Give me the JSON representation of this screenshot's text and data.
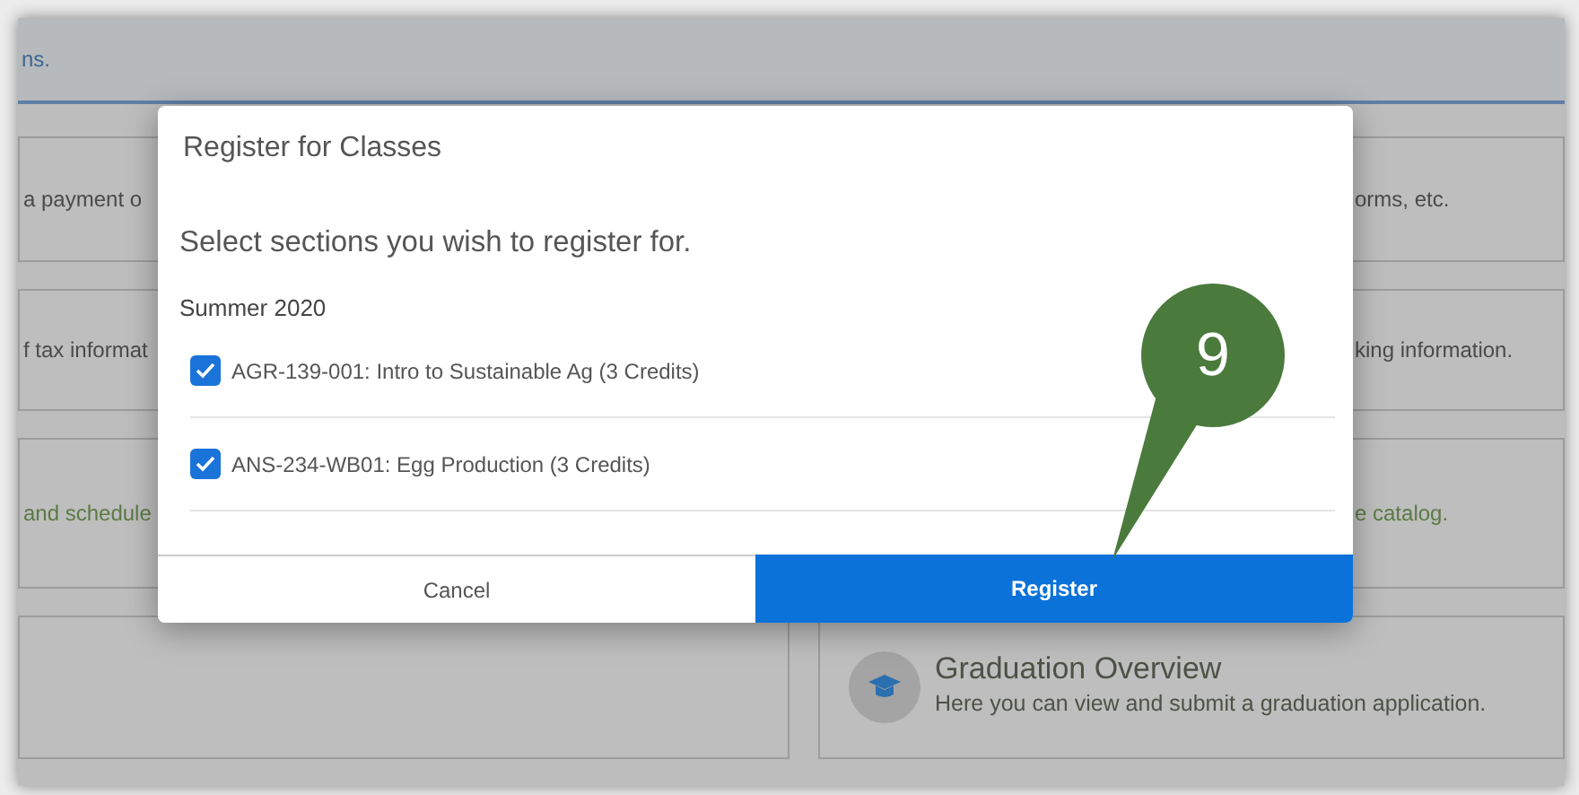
{
  "background": {
    "banner_text": "ns.",
    "cards": [
      {
        "kind": "text",
        "text": "a payment o"
      },
      {
        "kind": "text",
        "text": "orms, etc."
      },
      {
        "kind": "text",
        "text": "f tax informat"
      },
      {
        "kind": "text",
        "text": "king information."
      },
      {
        "kind": "link",
        "text": "and schedule"
      },
      {
        "kind": "link",
        "text": "e catalog."
      },
      {
        "kind": "empty"
      },
      {
        "kind": "feature",
        "title": "Graduation Overview",
        "text": "Here you can view and submit a graduation application."
      }
    ]
  },
  "dialog": {
    "title": "Register for Classes",
    "prompt": "Select sections you wish to register for.",
    "term": "Summer 2020",
    "sections": [
      {
        "label": "AGR-139-001: Intro to Sustainable Ag (3 Credits)",
        "checked": true
      },
      {
        "label": "ANS-234-WB01: Egg Production (3 Credits)",
        "checked": true
      }
    ],
    "buttons": [
      {
        "label": "Cancel",
        "kind": "secondary"
      },
      {
        "label": "Register",
        "kind": "primary"
      }
    ]
  },
  "callout": {
    "number": "9"
  }
}
